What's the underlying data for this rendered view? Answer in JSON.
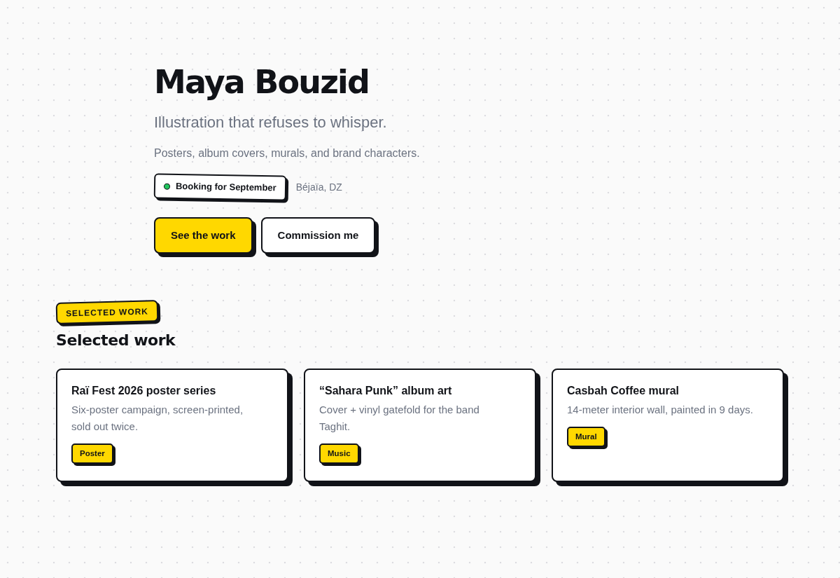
{
  "hero": {
    "name": "Maya Bouzid",
    "tagline": "Illustration that refuses to whisper.",
    "description": "Posters, album covers, murals, and brand characters.",
    "availability": {
      "label": "Booking for September",
      "color": "#22c55e"
    },
    "location": "Béjaïa, DZ",
    "buttons": [
      {
        "label": "See the work",
        "kind": "primary"
      },
      {
        "label": "Commission me",
        "kind": "secondary"
      }
    ]
  },
  "selected_work": {
    "eyebrow": "SELECTED WORK",
    "heading": "Selected work",
    "projects": [
      {
        "title": "Raï Fest 2026 poster series",
        "description": "Six-poster campaign, screen-printed, sold out twice.",
        "tag": "Poster"
      },
      {
        "title": "“Sahara Punk” album art",
        "description": "Cover + vinyl gatefold for the band Taghit.",
        "tag": "Music"
      },
      {
        "title": "Casbah Coffee mural",
        "description": "14-meter interior wall, painted in 9 days.",
        "tag": "Mural"
      }
    ]
  }
}
